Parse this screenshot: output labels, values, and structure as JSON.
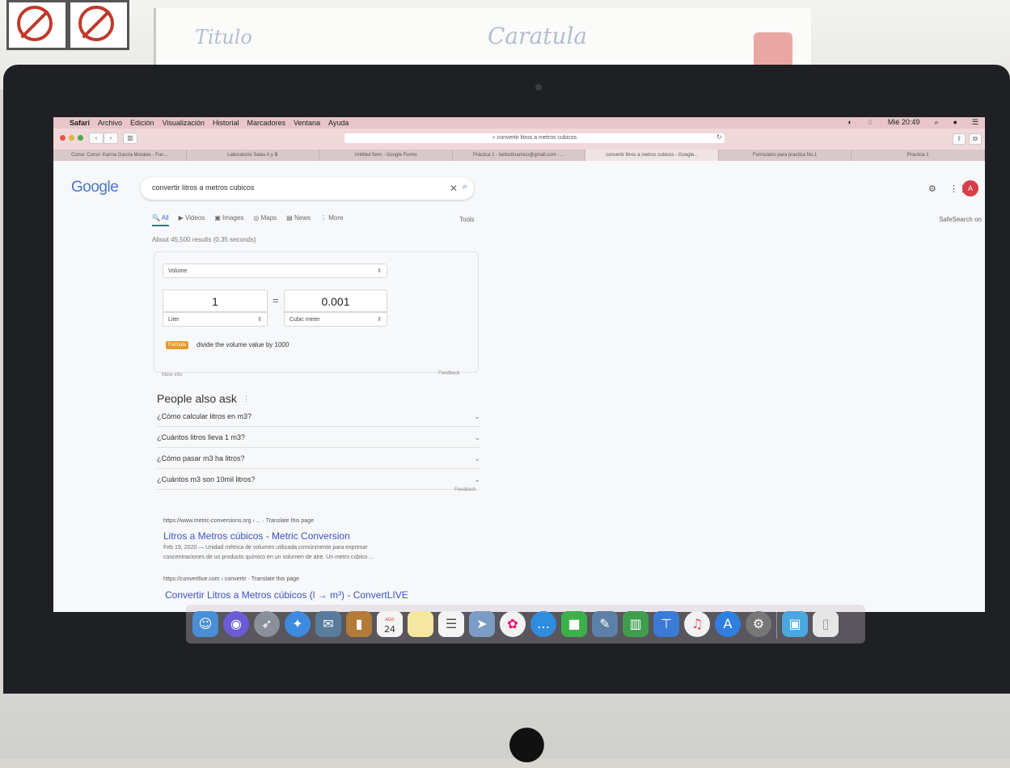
{
  "room": {
    "whiteboard_words": [
      "Titulo",
      "Caratula"
    ]
  },
  "menubar": {
    "apple": "",
    "app": "Safari",
    "items": [
      "Archivo",
      "Edición",
      "Visualización",
      "Historial",
      "Marcadores",
      "Ventana",
      "Ayuda"
    ],
    "clock": "Mié 20:49"
  },
  "toolbar": {
    "address": "convertir litros a metros cubicos"
  },
  "tabs": [
    "Curso: Curso: Karina García Morales - Fun...",
    "Laboratorio Salas A y B",
    "Untitled form - Google Forms",
    "Práctica 1 - bettodinamico@gmail.com - ...",
    "convertir litros a metros cubicos - Google...",
    "Formulario para practica No.1",
    "Práctica 1"
  ],
  "google": {
    "logo": "Google",
    "query": "convertir litros a metros cubicos",
    "clear": "✕",
    "avatar": "A",
    "nav": [
      {
        "icon": "🔍",
        "label": "All"
      },
      {
        "icon": "▶",
        "label": "Videos"
      },
      {
        "icon": "▣",
        "label": "Images"
      },
      {
        "icon": "◎",
        "label": "Maps"
      },
      {
        "icon": "▤",
        "label": "News"
      },
      {
        "icon": "⋮",
        "label": "More"
      }
    ],
    "tools": "Tools",
    "safesearch": "SafeSearch on",
    "stats": "About 45,500 results (0.35 seconds)"
  },
  "converter": {
    "category": "Volume",
    "from_value": "1",
    "equals": "=",
    "to_value": "0.001",
    "from_unit": "Liter",
    "to_unit": "Cubic meter",
    "formula_tag": "Formula",
    "formula": "divide the volume value by 1000",
    "more_info": "More info",
    "feedback": "Feedback"
  },
  "paa": {
    "title": "People also ask",
    "questions": [
      "¿Cómo calcular litros en m3?",
      "¿Cuántos litros lleva 1 m3?",
      "¿Cómo pasar m3 ha litros?",
      "¿Cuántos m3 son 10mil litros?"
    ],
    "feedback": "Feedback"
  },
  "results": [
    {
      "url": "https://www.metric-conversions.org › ... · Translate this page",
      "title": "Litros a Metros cúbicos - Metric Conversion",
      "snippet1": "Feb 19, 2020 — Unidad métrica de volumen utilizada comúnmente para expresar",
      "snippet2": "concentraciones de un producto químico en un volumen de aire. Un metro cúbico ..."
    },
    {
      "url": "https://convertlive.com › convertir · Translate this page",
      "title": "Convertir Litros a Metros cúbicos (l → m³) - ConvertLIVE"
    }
  ],
  "dock": {
    "calendar_month": "AGO",
    "calendar_day": "24"
  },
  "colors": {
    "google_blue": "#4a76c9",
    "link_blue": "#3b52c4",
    "menubar_pink": "#e7c5c8",
    "avatar_red": "#d93d47",
    "formula_orange": "#e69a2e"
  }
}
